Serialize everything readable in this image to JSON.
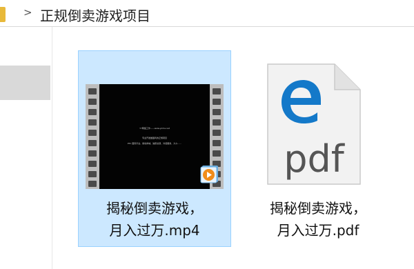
{
  "address_bar": {
    "separator": ">",
    "current_folder": "正规倒卖游戏项目"
  },
  "files": [
    {
      "name_line1": "揭秘倒卖游戏，",
      "name_line2": "月入过万.mp4",
      "type": "video",
      "selected": true,
      "thumbnail_lines": [
        "YY网络工作——www.yinhe.net",
        "专业开发做盈利的正规项目",
        "PTC 国际平台、移动商城、独家资源、外贸服务、大众……"
      ]
    },
    {
      "name_line1": "揭秘倒卖游戏，",
      "name_line2": "月入过万.pdf",
      "type": "pdf",
      "selected": false,
      "icon_text": "pdf"
    }
  ],
  "colors": {
    "selection_bg": "#cce8ff",
    "selection_border": "#99d1ff",
    "edge_blue": "#1479c9",
    "play_orange": "#f08c1a"
  }
}
